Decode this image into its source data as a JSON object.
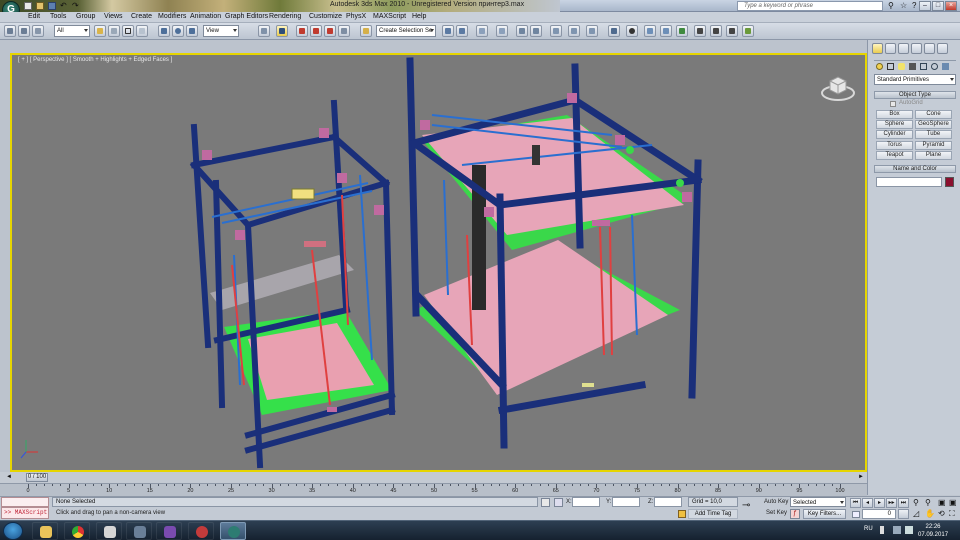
{
  "window": {
    "title": "Autodesk 3ds Max  2010  -  Unregistered Version     принтер3.max",
    "search_placeholder": "Type a keyword or phrase",
    "controls": [
      "–",
      "□",
      "×"
    ]
  },
  "menu": [
    "Edit",
    "Tools",
    "Group",
    "Views",
    "Create",
    "Modifiers",
    "Animation",
    "Graph Editors",
    "Rendering",
    "Customize",
    "MAXScript",
    "Help"
  ],
  "toolbar": {
    "selection_filter": "All",
    "ref_coord": "View",
    "named_selection": "Create Selection Se"
  },
  "viewport": {
    "label": "[ + ] [ Perspective ] [ Smooth + Highlights + Edged Faces ]"
  },
  "command_panel": {
    "category": "Standard Primitives",
    "object_type_title": "Object Type",
    "autogrid": "AutoGrid",
    "primitives": [
      "Box",
      "Cone",
      "Sphere",
      "GeoSphere",
      "Cylinder",
      "Tube",
      "Torus",
      "Pyramid",
      "Teapot",
      "Plane"
    ],
    "name_color_title": "Name and Color",
    "object_color": "#8b0f2e"
  },
  "timeline": {
    "slider": "0 / 100",
    "ticks": [
      "0",
      "5",
      "10",
      "15",
      "20",
      "25",
      "30",
      "35",
      "40",
      "45",
      "50",
      "55",
      "60",
      "65",
      "70",
      "75",
      "80",
      "85",
      "90",
      "95",
      "100"
    ]
  },
  "status": {
    "maxscript": ">> MAXScript",
    "selection": "None Selected",
    "prompt": "Click and drag to pan a non-camera view",
    "x_label": "X:",
    "y_label": "Y:",
    "z_label": "Z:",
    "grid": "Grid = 10,0",
    "add_time_tag": "Add Time Tag",
    "auto_key": "Auto Key",
    "key_mode": "Selected",
    "set_key": "Set Key",
    "key_filters": "Key Filters...",
    "frame": "0"
  },
  "taskbar": {
    "lang": "RU",
    "time": "22:26",
    "date": "07.09.2017"
  }
}
